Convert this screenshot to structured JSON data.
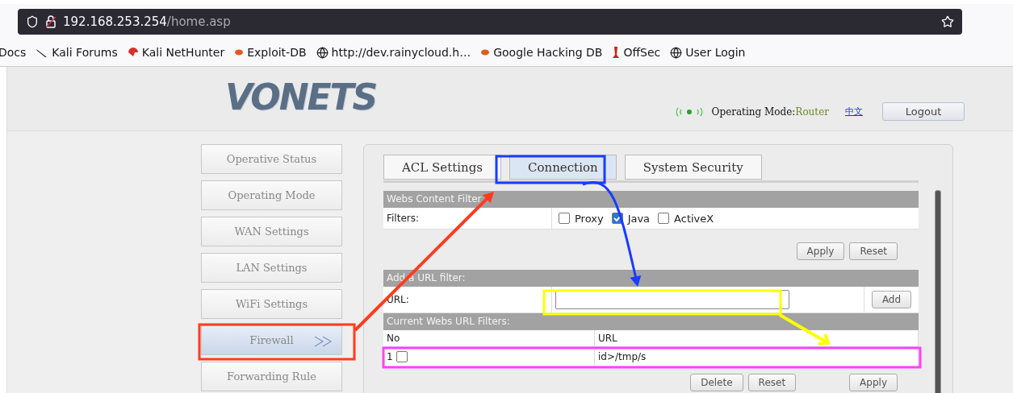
{
  "browser": {
    "url_host": "192.168.253.254",
    "url_path": "/home.asp",
    "bookmarks": [
      "Docs",
      "Kali Forums",
      "Kali NetHunter",
      "Exploit-DB",
      "http://dev.rainycloud.h…",
      "Google Hacking DB",
      "OffSec",
      "User Login"
    ]
  },
  "header": {
    "logo": "VONETS",
    "mode_label": "Operating Mode:",
    "mode_value": "Router",
    "language": "中文",
    "logout": "Logout"
  },
  "sidebar": {
    "items": [
      {
        "label": "Operative Status",
        "selected": false
      },
      {
        "label": "Operating Mode",
        "selected": false
      },
      {
        "label": "WAN Settings",
        "selected": false
      },
      {
        "label": "LAN Settings",
        "selected": false
      },
      {
        "label": "WiFi Settings",
        "selected": false
      },
      {
        "label": "Firewall",
        "selected": true
      },
      {
        "label": "Forwarding Rule",
        "selected": false
      }
    ]
  },
  "tabs": [
    {
      "label": "ACL Settings",
      "selected": false
    },
    {
      "label": "Connection",
      "selected": true
    },
    {
      "label": "System Security",
      "selected": false
    }
  ],
  "content_filter": {
    "title": "Webs Content Filter",
    "label": "Filters:",
    "options": [
      {
        "label": "Proxy",
        "checked": false
      },
      {
        "label": "Java",
        "checked": true
      },
      {
        "label": "ActiveX",
        "checked": false
      }
    ],
    "buttons": [
      "Apply",
      "Reset"
    ]
  },
  "url_filter": {
    "title": "Add a URL filter:",
    "label": "URL:",
    "button": "Add"
  },
  "current_filters": {
    "title": "Current Webs URL Filters:",
    "columns": [
      "No",
      "URL"
    ],
    "rows": [
      {
        "no": "1",
        "checked": false,
        "url": "id>/tmp/s"
      }
    ],
    "buttons": [
      "Delete",
      "Reset",
      "Apply"
    ]
  },
  "annotations": [
    {
      "kind": "frame",
      "color": "#ff3b1f"
    },
    {
      "kind": "frame",
      "color": "#1a3cff"
    },
    {
      "kind": "frame",
      "color": "#ffff00"
    },
    {
      "kind": "frame",
      "color": "#ff40ff"
    },
    {
      "kind": "arrow",
      "color": "#ff3b1f"
    },
    {
      "kind": "curve",
      "color": "#1a3cff"
    },
    {
      "kind": "arrow",
      "color": "#ffff00"
    }
  ]
}
